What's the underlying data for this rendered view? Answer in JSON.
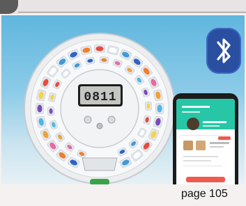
{
  "display": {
    "time": "0811"
  },
  "page_label": "page 105",
  "icons": {
    "bluetooth": "bluetooth-icon"
  },
  "colors": {
    "sky_top": "#5fb6de",
    "bluetooth_badge": "#2a4fa0",
    "ring_green": "#57b84a",
    "app_teal": "#27c6a6",
    "app_button": "#f05a4d"
  }
}
